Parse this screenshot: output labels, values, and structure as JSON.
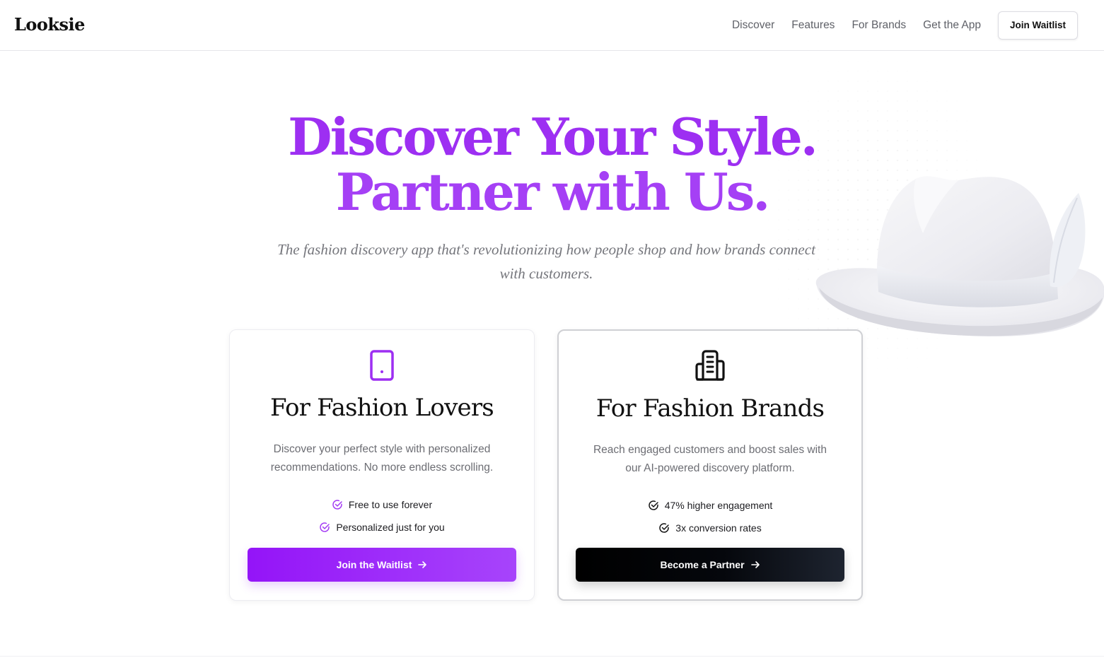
{
  "header": {
    "logo": "Looksie",
    "nav": [
      "Discover",
      "Features",
      "For Brands",
      "Get the App"
    ],
    "cta": "Join Waitlist"
  },
  "hero": {
    "title_line1": "Discover Your Style.",
    "title_line2": "Partner with Us.",
    "subtitle": "The fashion discovery app that's revolutionizing how people shop and how brands connect with customers."
  },
  "cards": [
    {
      "icon": "phone-icon",
      "title": "For Fashion Lovers",
      "description": "Discover your perfect style with personalized recommendations. No more endless scrolling.",
      "features": [
        "Free to use forever",
        "Personalized just for you"
      ],
      "button": "Join the Waitlist"
    },
    {
      "icon": "building-icon",
      "title": "For Fashion Brands",
      "description": "Reach engaged customers and boost sales with our AI-powered discovery platform.",
      "features": [
        "47% higher engagement",
        "3x conversion rates"
      ],
      "button": "Become a Partner"
    }
  ],
  "colors": {
    "accent": "#9d2ff2",
    "accent_light": "#a744fb",
    "dark_button": "#000000",
    "muted_text": "#6c6d73"
  }
}
